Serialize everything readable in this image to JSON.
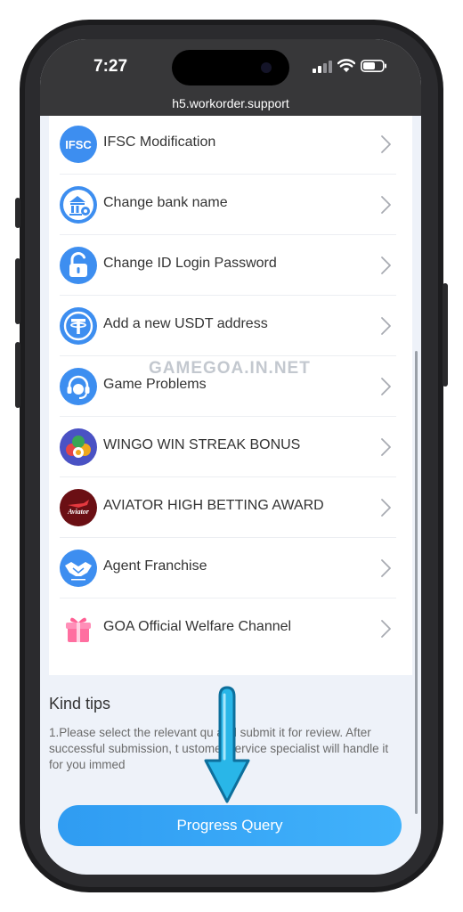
{
  "status_bar": {
    "time": "7:27"
  },
  "browser": {
    "url": "h5.workorder.support"
  },
  "menu": {
    "items": [
      {
        "label": "IFSC Modification",
        "icon": "ifsc-icon",
        "icon_text": "IFSC"
      },
      {
        "label": "Change bank name",
        "icon": "bank-icon"
      },
      {
        "label": "Change ID Login Password",
        "icon": "lock-icon"
      },
      {
        "label": "Add a new USDT address",
        "icon": "usdt-icon"
      },
      {
        "label": "Game Problems",
        "icon": "headset-icon"
      },
      {
        "label": "WINGO WIN STREAK BONUS",
        "icon": "wingo-icon"
      },
      {
        "label": "AVIATOR HIGH BETTING AWARD",
        "icon": "aviator-icon",
        "icon_text": "Aviator"
      },
      {
        "label": "Agent Franchise",
        "icon": "handshake-icon"
      },
      {
        "label": "GOA Official Welfare Channel",
        "icon": "gift-icon"
      }
    ]
  },
  "tips": {
    "title": "Kind tips",
    "body": "1.Please select the relevant qu and submit it for review. After successful submission, t ustomer service specialist will handle it for you immed"
  },
  "actions": {
    "progress_query": "Progress Query"
  },
  "watermark": "GAMEGOA.IN.NET",
  "colors": {
    "primary": "#2f9cf2",
    "status_bar": "#373739",
    "background": "#eef2f9"
  }
}
